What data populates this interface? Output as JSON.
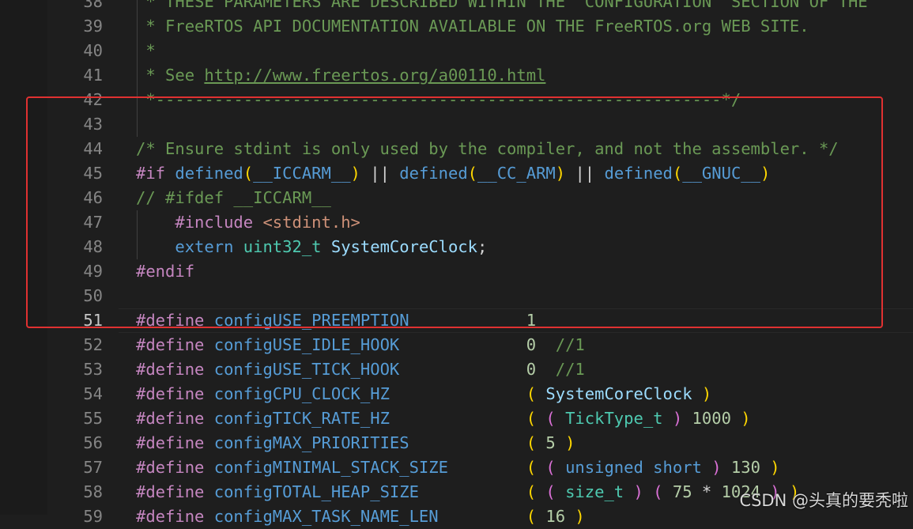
{
  "lines": [
    {
      "n": "38",
      "t": [
        {
          "c": "c",
          "v": " * THESE PARAMETERS ARE DESCRIBED WITHIN THE 'CONFIGURATION' SECTION OF THE"
        }
      ]
    },
    {
      "n": "39",
      "t": [
        {
          "c": "c",
          "v": " * FreeRTOS API DOCUMENTATION AVAILABLE ON THE FreeRTOS.org WEB SITE."
        }
      ]
    },
    {
      "n": "40",
      "t": [
        {
          "c": "c",
          "v": " *"
        }
      ]
    },
    {
      "n": "41",
      "t": [
        {
          "c": "c",
          "v": " * See "
        },
        {
          "c": "c u",
          "v": "http://www.freertos.org/a00110.html"
        }
      ]
    },
    {
      "n": "42",
      "t": [
        {
          "c": "c",
          "v": " *----------------------------------------------------------*/"
        }
      ]
    },
    {
      "n": "43",
      "t": []
    },
    {
      "n": "44",
      "t": [
        {
          "c": "c",
          "v": "/* Ensure stdint is only used by the compiler, and not the assembler. */"
        }
      ]
    },
    {
      "n": "45",
      "t": [
        {
          "c": "pp",
          "v": "#if "
        },
        {
          "c": "kw",
          "v": "defined"
        },
        {
          "c": "py",
          "v": "("
        },
        {
          "c": "mac",
          "v": "__ICCARM__"
        },
        {
          "c": "py",
          "v": ")"
        },
        {
          "v": " || "
        },
        {
          "c": "kw",
          "v": "defined"
        },
        {
          "c": "py",
          "v": "("
        },
        {
          "c": "mac",
          "v": "__CC_ARM"
        },
        {
          "c": "py",
          "v": ")"
        },
        {
          "v": " || "
        },
        {
          "c": "kw",
          "v": "defined"
        },
        {
          "c": "py",
          "v": "("
        },
        {
          "c": "mac",
          "v": "__GNUC__"
        },
        {
          "c": "py",
          "v": ")"
        }
      ]
    },
    {
      "n": "46",
      "t": [
        {
          "c": "c",
          "v": "// #ifdef __ICCARM__"
        }
      ]
    },
    {
      "n": "47",
      "guide": true,
      "t": [
        {
          "c": "pp",
          "v": "    #include "
        },
        {
          "c": "str",
          "v": "<stdint.h>"
        }
      ]
    },
    {
      "n": "48",
      "guide": true,
      "t": [
        {
          "c": "kw",
          "v": "    extern "
        },
        {
          "c": "ty",
          "v": "uint32_t "
        },
        {
          "c": "id",
          "v": "SystemCoreClock"
        },
        {
          "v": ";"
        }
      ]
    },
    {
      "n": "49",
      "t": [
        {
          "c": "pp",
          "v": "#endif"
        }
      ]
    },
    {
      "n": "50",
      "t": []
    },
    {
      "n": "51",
      "current": true,
      "t": [
        {
          "c": "pp",
          "v": "#define "
        },
        {
          "c": "mac",
          "v": "configUSE_PREEMPTION"
        },
        {
          "v": "            "
        },
        {
          "c": "num",
          "v": "1"
        }
      ]
    },
    {
      "n": "52",
      "t": [
        {
          "c": "pp",
          "v": "#define "
        },
        {
          "c": "mac",
          "v": "configUSE_IDLE_HOOK"
        },
        {
          "v": "             "
        },
        {
          "c": "num",
          "v": "0"
        },
        {
          "v": "  "
        },
        {
          "c": "c",
          "v": "//1"
        }
      ]
    },
    {
      "n": "53",
      "t": [
        {
          "c": "pp",
          "v": "#define "
        },
        {
          "c": "mac",
          "v": "configUSE_TICK_HOOK"
        },
        {
          "v": "             "
        },
        {
          "c": "num",
          "v": "0"
        },
        {
          "v": "  "
        },
        {
          "c": "c",
          "v": "//1"
        }
      ]
    },
    {
      "n": "54",
      "t": [
        {
          "c": "pp",
          "v": "#define "
        },
        {
          "c": "mac",
          "v": "configCPU_CLOCK_HZ"
        },
        {
          "v": "              "
        },
        {
          "c": "py",
          "v": "( "
        },
        {
          "c": "id",
          "v": "SystemCoreClock"
        },
        {
          "c": "py",
          "v": " )"
        }
      ]
    },
    {
      "n": "55",
      "t": [
        {
          "c": "pp",
          "v": "#define "
        },
        {
          "c": "mac",
          "v": "configTICK_RATE_HZ"
        },
        {
          "v": "              "
        },
        {
          "c": "py",
          "v": "( "
        },
        {
          "c": "pp2",
          "v": "( "
        },
        {
          "c": "ty",
          "v": "TickType_t"
        },
        {
          "c": "pp2",
          "v": " ) "
        },
        {
          "c": "num",
          "v": "1000"
        },
        {
          "c": "py",
          "v": " )"
        }
      ]
    },
    {
      "n": "56",
      "t": [
        {
          "c": "pp",
          "v": "#define "
        },
        {
          "c": "mac",
          "v": "configMAX_PRIORITIES"
        },
        {
          "v": "            "
        },
        {
          "c": "py",
          "v": "( "
        },
        {
          "c": "num",
          "v": "5"
        },
        {
          "c": "py",
          "v": " )"
        }
      ]
    },
    {
      "n": "57",
      "t": [
        {
          "c": "pp",
          "v": "#define "
        },
        {
          "c": "mac",
          "v": "configMINIMAL_STACK_SIZE"
        },
        {
          "v": "        "
        },
        {
          "c": "py",
          "v": "( "
        },
        {
          "c": "pp2",
          "v": "( "
        },
        {
          "c": "kw",
          "v": "unsigned short"
        },
        {
          "c": "pp2",
          "v": " ) "
        },
        {
          "c": "num",
          "v": "130"
        },
        {
          "c": "py",
          "v": " )"
        }
      ]
    },
    {
      "n": "58",
      "t": [
        {
          "c": "pp",
          "v": "#define "
        },
        {
          "c": "mac",
          "v": "configTOTAL_HEAP_SIZE"
        },
        {
          "v": "           "
        },
        {
          "c": "py",
          "v": "( "
        },
        {
          "c": "pp2",
          "v": "( "
        },
        {
          "c": "ty",
          "v": "size_t"
        },
        {
          "c": "pp2",
          "v": " ) ( "
        },
        {
          "c": "num",
          "v": "75"
        },
        {
          "v": " * "
        },
        {
          "c": "num",
          "v": "1024"
        },
        {
          "c": "pp2",
          "v": " ) "
        },
        {
          "c": "py",
          "v": ")"
        }
      ]
    },
    {
      "n": "59",
      "t": [
        {
          "c": "pp",
          "v": "#define "
        },
        {
          "c": "mac",
          "v": "configMAX_TASK_NAME_LEN"
        },
        {
          "v": "         "
        },
        {
          "c": "py",
          "v": "( "
        },
        {
          "c": "num",
          "v": "16"
        },
        {
          "c": "py",
          "v": " )"
        }
      ]
    }
  ],
  "watermark": "CSDN @头真的要秃啦",
  "annotation": {
    "color": "#e03131"
  }
}
